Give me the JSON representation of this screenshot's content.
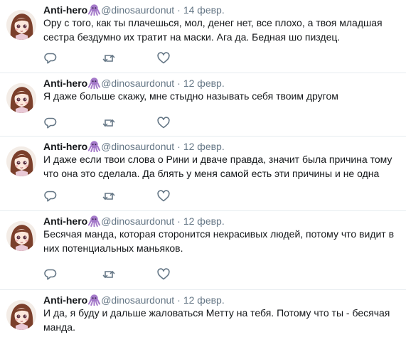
{
  "colors": {
    "name": "#14171a",
    "meta": "#657786",
    "octopus": "#a479c9",
    "divider": "#e6ecf0"
  },
  "icons": [
    "user-avatar",
    "octopus-emoji",
    "reply-icon",
    "retweet-icon",
    "like-icon"
  ],
  "tweets": [
    {
      "name": "Anti-hero",
      "handle": "@dinosaurdonut",
      "separator": "·",
      "date": "14 февр.",
      "lines": [
        "Ору с того, как ты плачешься, мол, денег нет, все плохо, а твоя младшая",
        "сестра бездумно их тратит на маски. Ага да. Бедная шо пиздец."
      ]
    },
    {
      "name": "Anti-hero",
      "handle": "@dinosaurdonut",
      "separator": "·",
      "date": "12 февр.",
      "lines": [
        "Я даже больше скажу, мне стыдно называть себя твоим другом"
      ]
    },
    {
      "name": "Anti-hero",
      "handle": "@dinosaurdonut",
      "separator": "·",
      "date": "12 февр.",
      "lines": [
        "И даже если твои слова о Рини и дваче правда, значит была причина тому",
        "что она это сделала. Да блять у меня самой есть эти причины и не одна"
      ]
    },
    {
      "name": "Anti-hero",
      "handle": "@dinosaurdonut",
      "separator": "·",
      "date": "12 февр.",
      "lines": [
        "Бесячая манда, которая сторонится некрасивых людей, потому что видит в",
        "них потенциальных маньяков."
      ]
    },
    {
      "name": "Anti-hero",
      "handle": "@dinosaurdonut",
      "separator": "·",
      "date": "12 февр.",
      "lines": [
        "И да, я буду и дальше жаловаться Метту на тебя. Потому что ты - бесячая",
        "манда."
      ]
    }
  ]
}
